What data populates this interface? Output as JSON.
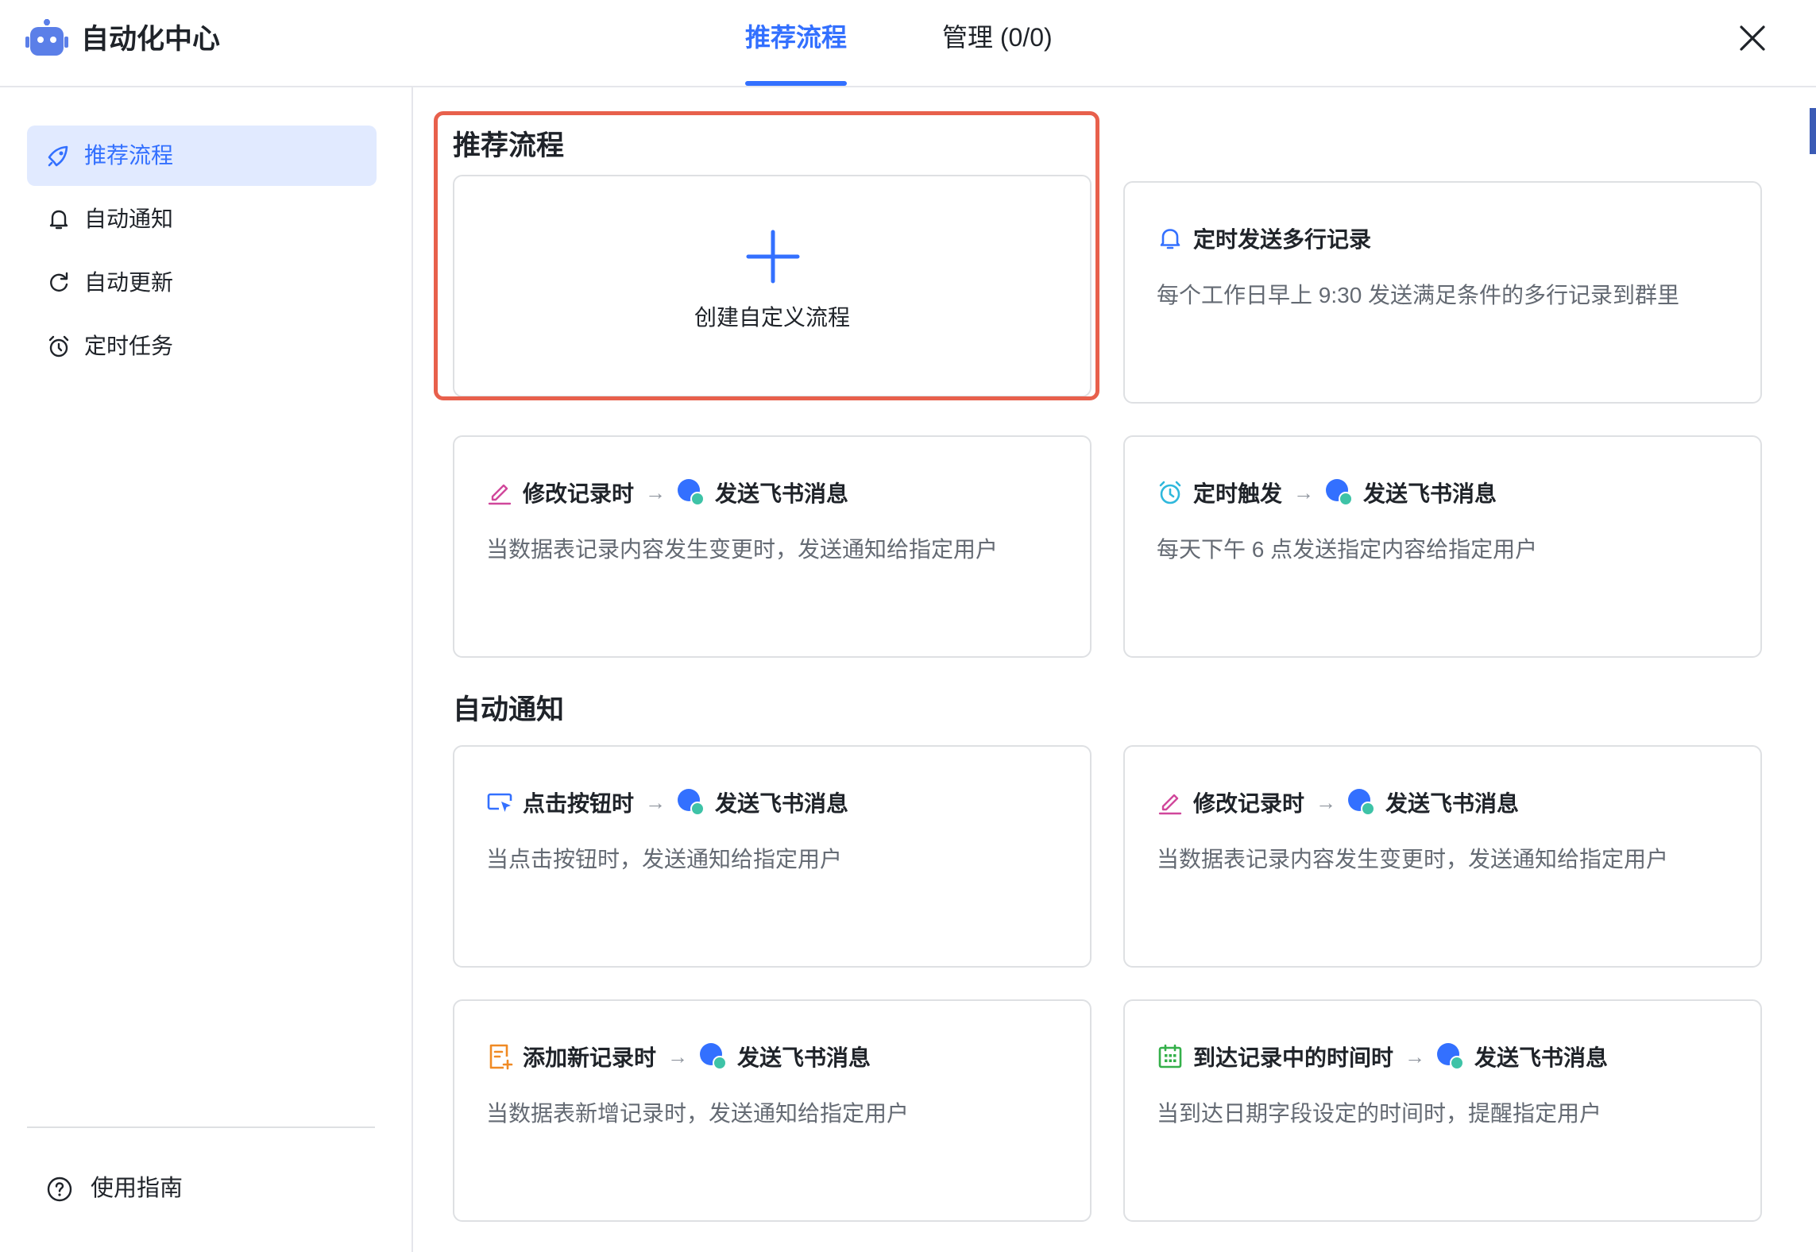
{
  "header": {
    "app_title": "自动化中心",
    "tabs": [
      {
        "label": "推荐流程",
        "active": true
      },
      {
        "label": "管理 (0/0)",
        "active": false
      }
    ]
  },
  "sidebar": {
    "items": [
      {
        "label": "推荐流程",
        "icon": "rocket-icon",
        "active": true
      },
      {
        "label": "自动通知",
        "icon": "bell-icon",
        "active": false
      },
      {
        "label": "自动更新",
        "icon": "refresh-icon",
        "active": false
      },
      {
        "label": "定时任务",
        "icon": "alarm-clock-icon",
        "active": false
      }
    ],
    "guide_label": "使用指南"
  },
  "sections": {
    "recommended_title": "推荐流程",
    "notify_title": "自动通知"
  },
  "create_card": {
    "label": "创建自定义流程"
  },
  "cards": {
    "scheduled_multi": {
      "icon": "bell-icon",
      "trigger": "定时发送多行记录",
      "desc": "每个工作日早上 9:30 发送满足条件的多行记录到群里"
    },
    "edit_record_1": {
      "icon": "pencil-icon",
      "trigger": "修改记录时",
      "arrow": "→",
      "action": "发送飞书消息",
      "desc": "当数据表记录内容发生变更时，发送通知给指定用户"
    },
    "timed_trigger": {
      "icon": "alarm-clock-icon",
      "trigger": "定时触发",
      "arrow": "→",
      "action": "发送飞书消息",
      "desc": "每天下午 6 点发送指定内容给指定用户"
    },
    "click_button": {
      "icon": "button-click-icon",
      "trigger": "点击按钮时",
      "arrow": "→",
      "action": "发送飞书消息",
      "desc": "当点击按钮时，发送通知给指定用户"
    },
    "edit_record_2": {
      "icon": "pencil-icon",
      "trigger": "修改记录时",
      "arrow": "→",
      "action": "发送飞书消息",
      "desc": "当数据表记录内容发生变更时，发送通知给指定用户"
    },
    "add_record": {
      "icon": "add-record-icon",
      "trigger": "添加新记录时",
      "arrow": "→",
      "action": "发送飞书消息",
      "desc": "当数据表新增记录时，发送通知给指定用户"
    },
    "reach_time": {
      "icon": "calendar-icon",
      "trigger": "到达记录中的时间时",
      "arrow": "→",
      "action": "发送飞书消息",
      "desc": "当到达日期字段设定的时间时，提醒指定用户"
    }
  },
  "colors": {
    "accent": "#3370ff",
    "highlight_border": "#e8604c",
    "active_nav_bg": "#e1eaff"
  }
}
